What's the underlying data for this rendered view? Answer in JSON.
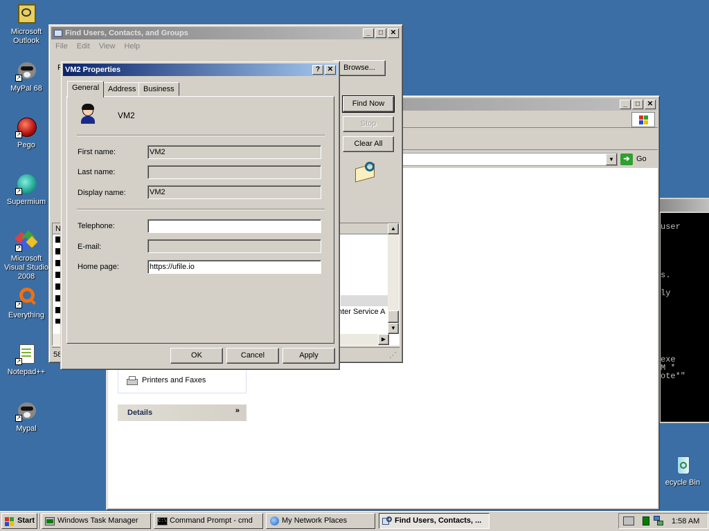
{
  "desktop": {
    "icons": [
      {
        "label": "Microsoft Outlook",
        "icon": "outlook-icon"
      },
      {
        "label": "MyPal 68",
        "icon": "raccoon-icon"
      },
      {
        "label": "Pego",
        "icon": "pego-icon"
      },
      {
        "label": "Supermium",
        "icon": "supermium-icon"
      },
      {
        "label": "Microsoft Visual Studio 2008",
        "icon": "visual-studio-icon"
      },
      {
        "label": "Everything",
        "icon": "everything-icon"
      },
      {
        "label": "Notepad++",
        "icon": "notepadpp-icon"
      },
      {
        "label": "Mypal",
        "icon": "raccoon-icon"
      },
      {
        "label": "Recycle Bin",
        "visible_label": "ecycle Bin",
        "icon": "recycle-bin-icon"
      }
    ]
  },
  "find_window": {
    "title": "Find Users, Contacts, and Groups",
    "menu": [
      "File",
      "Edit",
      "View",
      "Help"
    ],
    "browse_button": "Browse...",
    "find_now_button": "Find Now",
    "stop_button": "Stop",
    "clear_all_button": "Clear All",
    "list_header_partial": "N",
    "status_partial": "58",
    "row_partial_text": "nter Service A"
  },
  "explorer_window": {
    "go_label": "Go",
    "task_link": "Printers and Faxes",
    "details_label": "Details"
  },
  "cmd_window": {
    "visible_fragments": [
      "user",
      "s.",
      "ly",
      "exe",
      "M *",
      "ote*\""
    ]
  },
  "properties_dialog": {
    "title": "VM2 Properties",
    "help_btn": "?",
    "close_btn": "✕",
    "tabs": [
      "General",
      "Address",
      "Business"
    ],
    "selected_tab": "General",
    "contact_name": "VM2",
    "fields": {
      "first_name_label": "First name:",
      "first_name_value": "VM2",
      "last_name_label": "Last name:",
      "last_name_value": "",
      "display_name_label": "Display name:",
      "display_name_value": "VM2",
      "telephone_label": "Telephone:",
      "telephone_value": "",
      "email_label": "E-mail:",
      "email_value": "",
      "home_page_label": "Home page:",
      "home_page_value": "https://ufile.io"
    },
    "ok_button": "OK",
    "cancel_button": "Cancel",
    "apply_button": "Apply"
  },
  "taskbar": {
    "start_label": "Start",
    "buttons": [
      {
        "label": "Windows Task Manager",
        "icon": "task-manager-icon",
        "active": false
      },
      {
        "label": "Command Prompt - cmd",
        "icon": "cmd-icon",
        "active": false
      },
      {
        "label": "My Network Places",
        "icon": "network-places-icon",
        "active": false
      },
      {
        "label": "Find Users, Contacts, ...",
        "icon": "find-users-icon",
        "active": true
      }
    ],
    "clock": "1:58 AM"
  }
}
